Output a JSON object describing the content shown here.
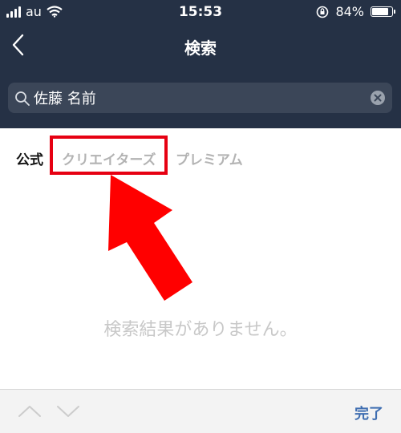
{
  "status_bar": {
    "carrier": "au",
    "time": "15:53",
    "battery_percent": "84%",
    "battery_level": 0.84
  },
  "header": {
    "title": "検索",
    "back_icon": "chevron-left-icon"
  },
  "search": {
    "value": "佐藤 名前",
    "search_icon": "search-icon",
    "clear_icon": "clear-icon"
  },
  "tabs": [
    {
      "label": "公式",
      "active": true
    },
    {
      "label": "クリエイターズ",
      "active": false,
      "highlighted": true
    },
    {
      "label": "プレミアム",
      "active": false
    }
  ],
  "annotation": {
    "highlight_color": "#e60012",
    "arrow_color": "#ff0000"
  },
  "results": {
    "empty_message": "検索結果がありません。"
  },
  "toolbar": {
    "done_label": "完了",
    "up_icon": "chevron-up-icon",
    "down_icon": "chevron-down-icon"
  },
  "colors": {
    "header_bg": "#253145",
    "search_bg": "#3b4658",
    "accent": "#3f6eb1"
  }
}
